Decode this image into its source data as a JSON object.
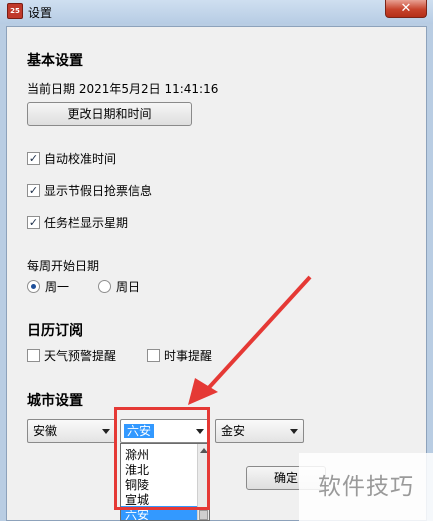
{
  "window": {
    "title": "设置",
    "close_label": "✕",
    "icon_text": "25"
  },
  "basic": {
    "heading": "基本设置",
    "current_date": "当前日期  2021年5月2日  11:41:16",
    "change_button": "更改日期和时间",
    "options": [
      {
        "label": "自动校准时间",
        "checked": true
      },
      {
        "label": "显示节假日抢票信息",
        "checked": true
      },
      {
        "label": "任务栏显示星期",
        "checked": true
      }
    ],
    "week_start_label": "每周开始日期",
    "week_options": [
      {
        "label": "周一",
        "selected": true
      },
      {
        "label": "周日",
        "selected": false
      }
    ]
  },
  "subscription": {
    "heading": "日历订阅",
    "options": [
      {
        "label": "天气预警提醒",
        "checked": false
      },
      {
        "label": "时事提醒",
        "checked": false
      }
    ]
  },
  "city": {
    "heading": "城市设置",
    "province": "安徽",
    "city": "六安",
    "district": "金安",
    "dropdown_items": [
      "滁州",
      "淮北",
      "铜陵",
      "宣城",
      "六安"
    ]
  },
  "ok_button": "确定",
  "watermark": "软件技巧",
  "accent_color": "#e53935"
}
